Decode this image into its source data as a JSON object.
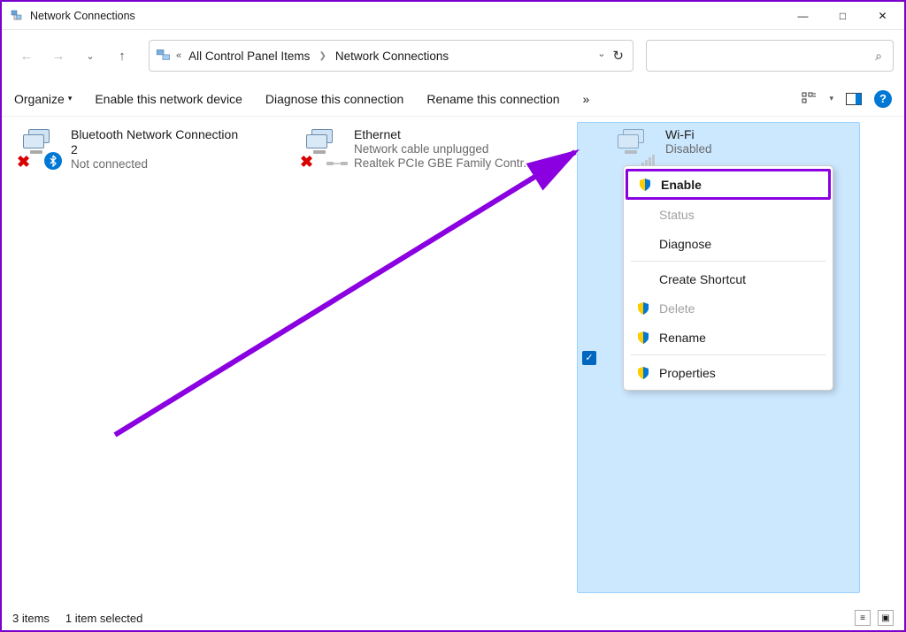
{
  "window": {
    "title": "Network Connections"
  },
  "breadcrumb": {
    "prefix": "«",
    "items": [
      "All Control Panel Items",
      "Network Connections"
    ]
  },
  "toolbar": {
    "organize": "Organize",
    "enable": "Enable this network device",
    "diagnose": "Diagnose this connection",
    "rename": "Rename this connection",
    "overflow": "»"
  },
  "connections": [
    {
      "name1": "Bluetooth Network Connection",
      "name2": "2",
      "status": "Not connected",
      "badge": "bluetooth",
      "hasX": true
    },
    {
      "name1": "Ethernet",
      "name2": "Network cable unplugged",
      "status": "Realtek PCIe GBE Family Contr...",
      "badge": "ethernet",
      "hasX": true
    },
    {
      "name1": "Wi-Fi",
      "name2": "Disabled",
      "status": "",
      "badge": "wifi",
      "selected": true
    }
  ],
  "context_menu": {
    "items": [
      {
        "label": "Enable",
        "shield": true,
        "highlighted": true
      },
      {
        "label": "Status",
        "disabled": true
      },
      {
        "label": "Diagnose"
      },
      {
        "sep": true
      },
      {
        "label": "Create Shortcut"
      },
      {
        "label": "Delete",
        "shield": true,
        "disabled": true
      },
      {
        "label": "Rename",
        "shield": true
      },
      {
        "sep": true
      },
      {
        "label": "Properties",
        "shield": true
      }
    ]
  },
  "statusbar": {
    "count": "3 items",
    "selected": "1 item selected"
  }
}
